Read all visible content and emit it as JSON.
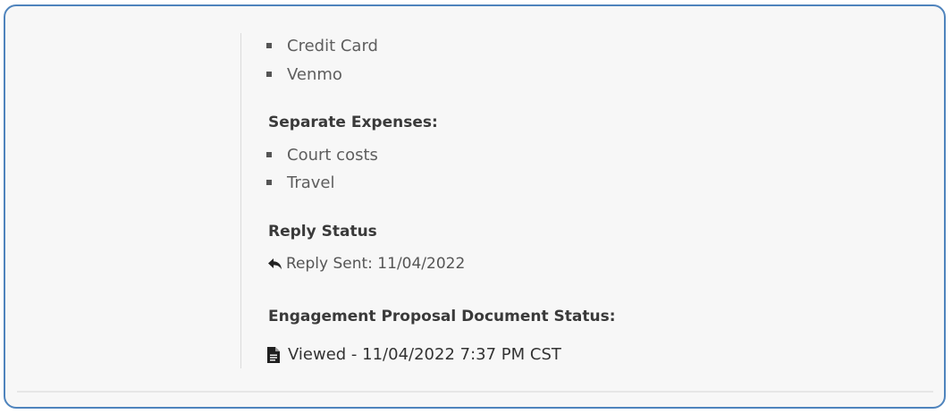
{
  "payment_methods": {
    "items": [
      "Credit Card",
      "Venmo"
    ]
  },
  "separate_expenses": {
    "heading": "Separate Expenses:",
    "items": [
      "Court costs",
      "Travel"
    ]
  },
  "reply_status": {
    "heading": "Reply Status",
    "icon": "reply-icon",
    "text": "Reply Sent: 11/04/2022"
  },
  "document_status": {
    "heading": "Engagement Proposal Document Status:",
    "icon": "document-icon",
    "text": "Viewed - 11/04/2022 7:37 PM CST"
  }
}
